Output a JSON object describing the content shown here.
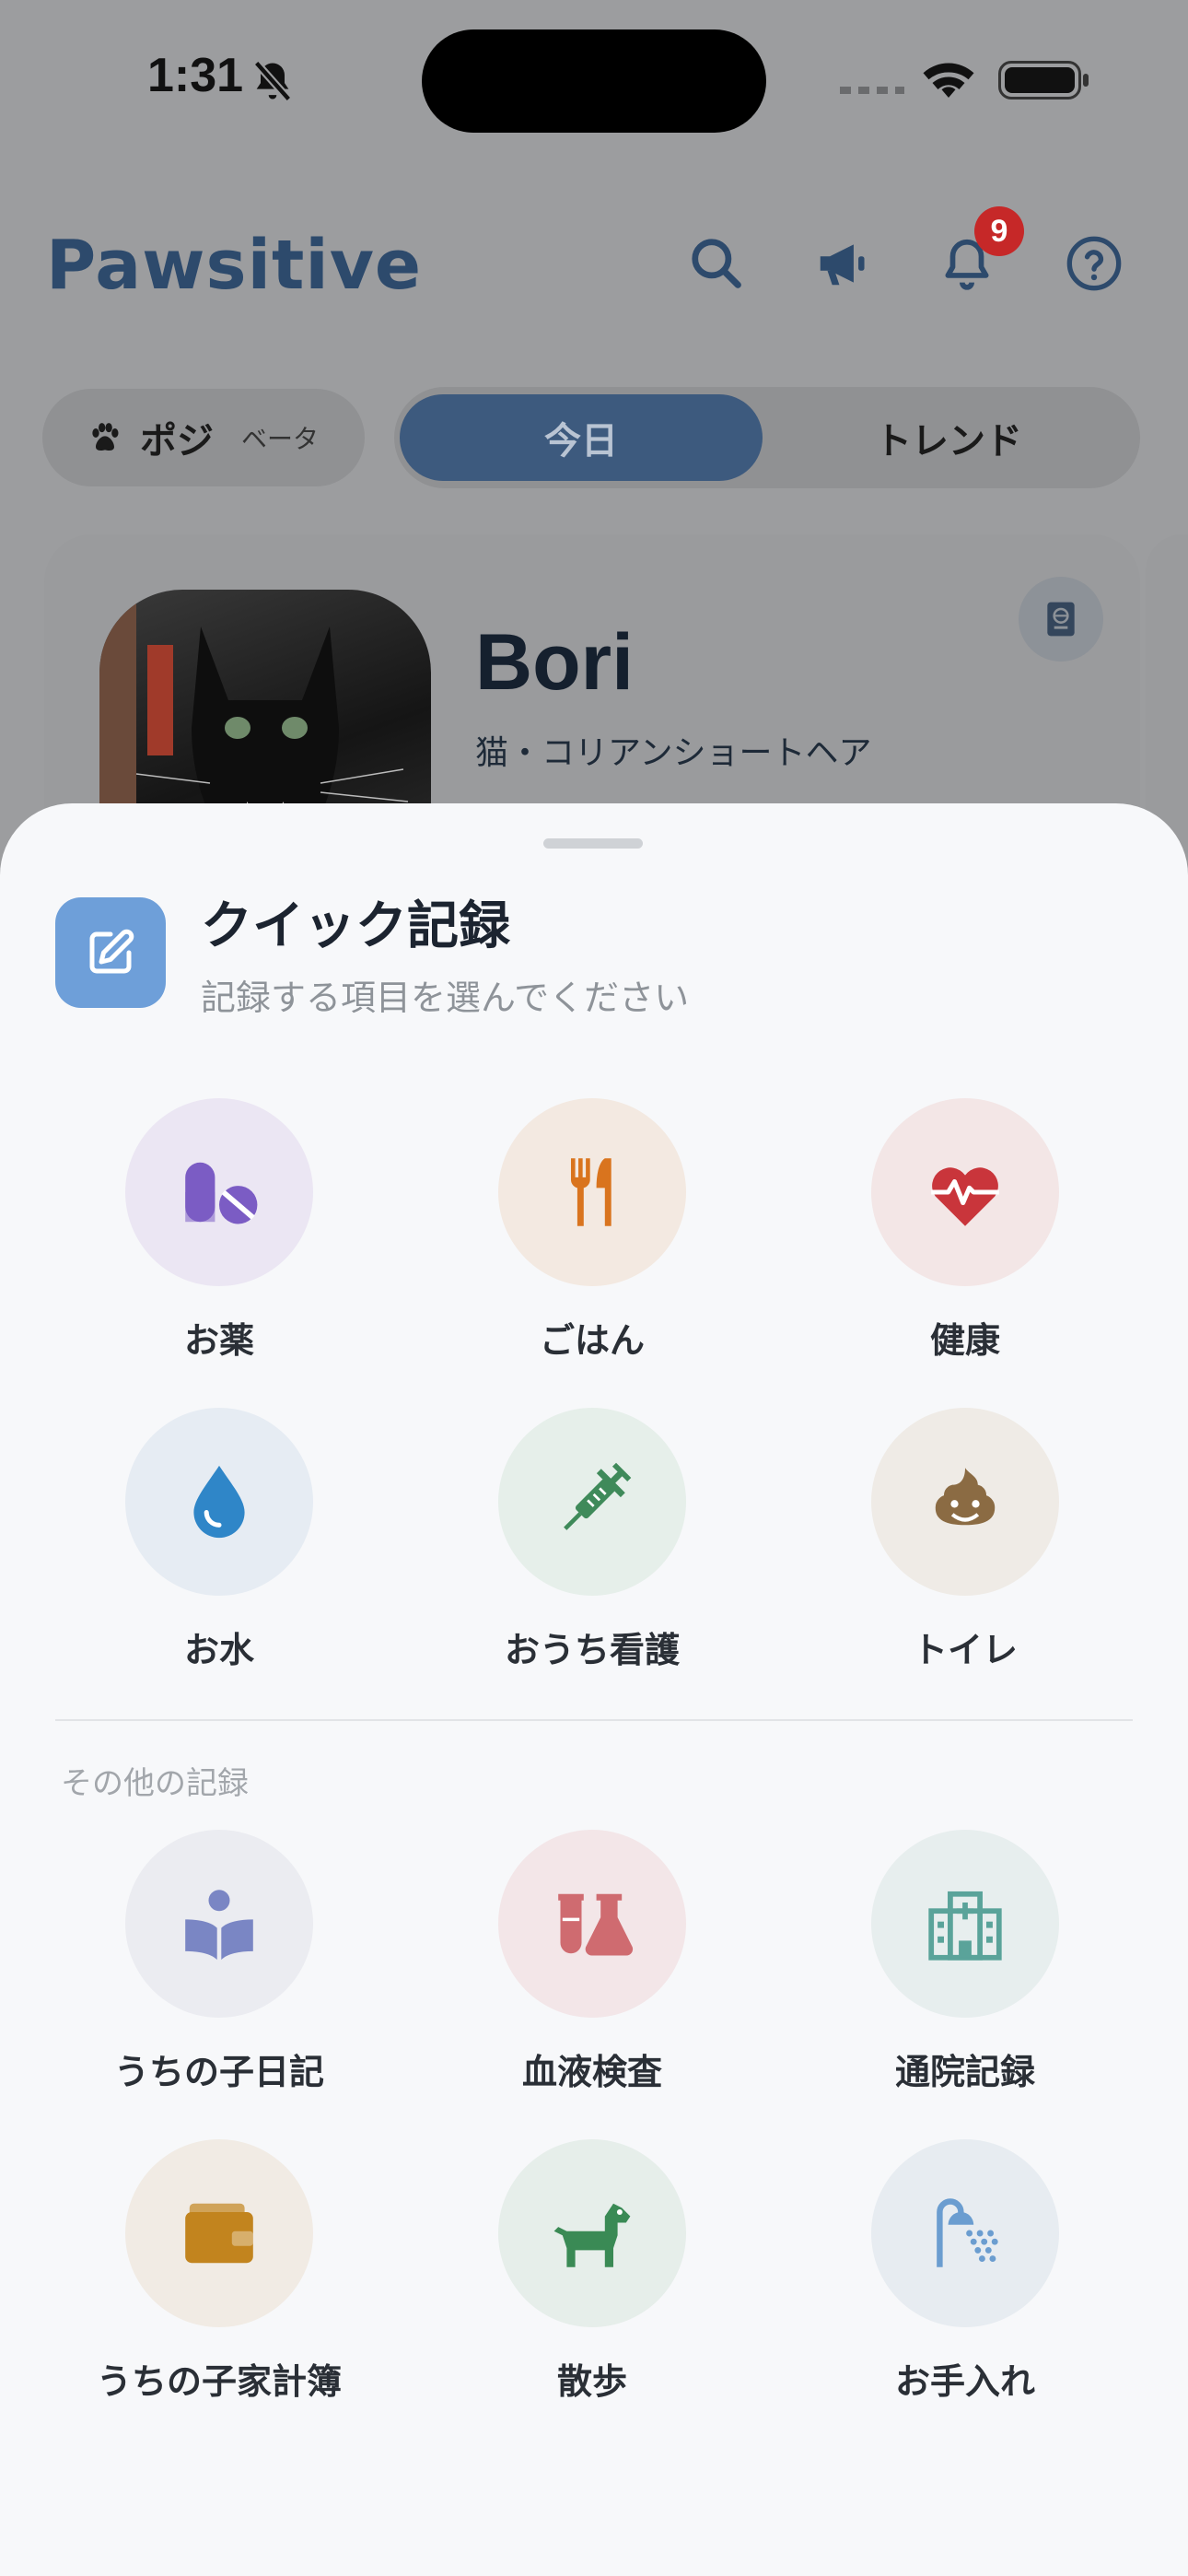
{
  "status_bar": {
    "time": "1:31"
  },
  "header": {
    "app_name": "Pawsitive",
    "notification_count": "9"
  },
  "tabs": {
    "posi_label": "ポジ",
    "posi_beta": "ベータ",
    "today": "今日",
    "trend": "トレンド"
  },
  "pet": {
    "name": "Bori",
    "breed": "猫・コリアンショートヘア"
  },
  "sheet": {
    "title": "クイック記録",
    "subtitle": "記録する項目を選んでください",
    "other_header": "その他の記録",
    "quick_items": [
      {
        "label": "お薬",
        "icon": "pills-icon",
        "bg": "#ebe6f3",
        "color": "#7b5cc4"
      },
      {
        "label": "ごはん",
        "icon": "utensils-icon",
        "bg": "#f3e9e1",
        "color": "#d9741e"
      },
      {
        "label": "健康",
        "icon": "heart-pulse-icon",
        "bg": "#f3e6e6",
        "color": "#c9353b"
      },
      {
        "label": "お水",
        "icon": "water-drop-icon",
        "bg": "#e6ecf3",
        "color": "#2f86c8"
      },
      {
        "label": "おうち看護",
        "icon": "syringe-icon",
        "bg": "#e6efea",
        "color": "#3f8a5a"
      },
      {
        "label": "トイレ",
        "icon": "poop-icon",
        "bg": "#efebe6",
        "color": "#8b6b43"
      }
    ],
    "other_items": [
      {
        "label": "うちの子日記",
        "icon": "book-reader-icon",
        "bg": "#ebecf1",
        "color": "#7a86c4"
      },
      {
        "label": "血液検査",
        "icon": "flask-icon",
        "bg": "#f3e6e8",
        "color": "#cf6b70"
      },
      {
        "label": "通院記録",
        "icon": "hospital-icon",
        "bg": "#e7eeee",
        "color": "#5aa39a"
      },
      {
        "label": "うちの子家計簿",
        "icon": "wallet-icon",
        "bg": "#f1ebe4",
        "color": "#c2841e"
      },
      {
        "label": "散歩",
        "icon": "dog-icon",
        "bg": "#e6eeea",
        "color": "#3a8a55"
      },
      {
        "label": "お手入れ",
        "icon": "shower-icon",
        "bg": "#e7ecf1",
        "color": "#6b9dd0"
      }
    ]
  }
}
